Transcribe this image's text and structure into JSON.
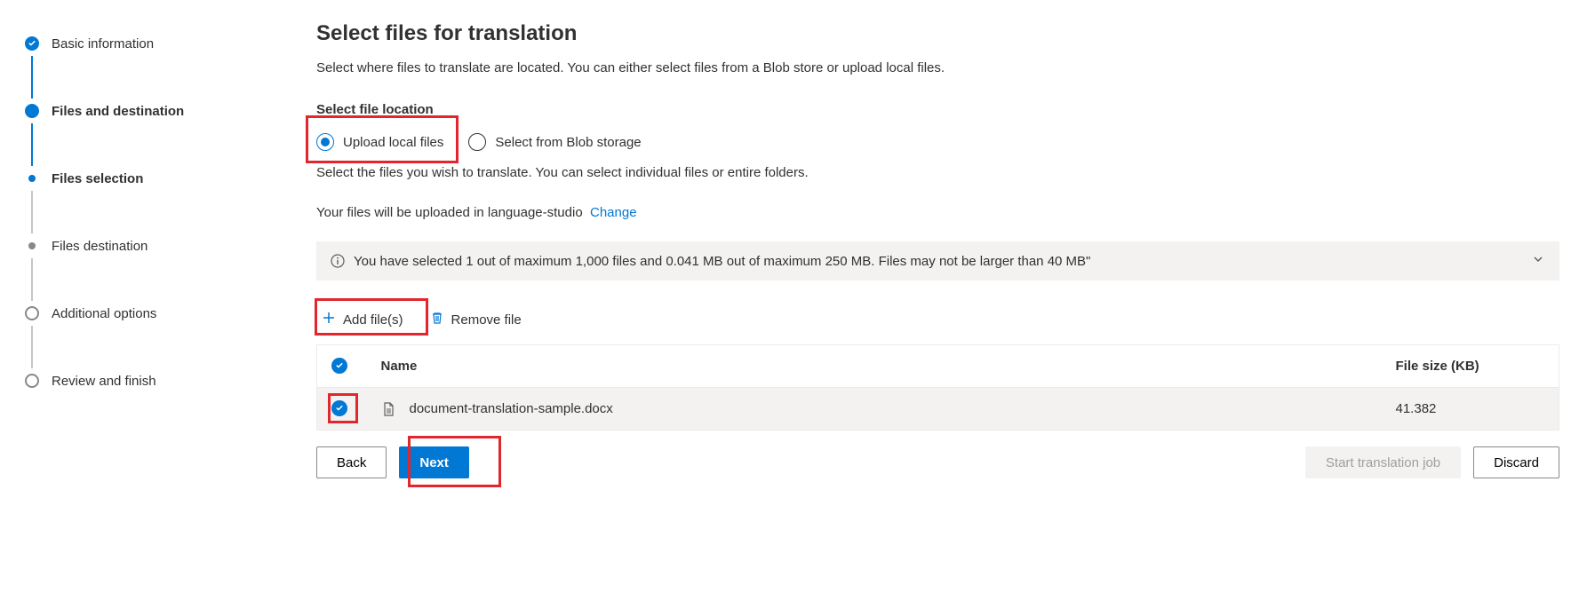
{
  "stepper": {
    "items": [
      {
        "label": "Basic information",
        "state": "done"
      },
      {
        "label": "Files and destination",
        "state": "active",
        "bold": true
      },
      {
        "label": "Files selection",
        "state": "sub-active",
        "bold": true,
        "sub": true
      },
      {
        "label": "Files destination",
        "state": "sub-idle",
        "sub": true
      },
      {
        "label": "Additional options",
        "state": "idle"
      },
      {
        "label": "Review and finish",
        "state": "idle"
      }
    ]
  },
  "main": {
    "title": "Select files for translation",
    "subtitle": "Select where files to translate are located. You can either select files from a Blob store or upload local files.",
    "section_label": "Select file location",
    "radio": {
      "upload_local": "Upload local files",
      "blob": "Select from Blob storage",
      "selected": "upload_local"
    },
    "desc": "Select the files you wish to translate. You can select individual files or entire folders.",
    "upload_prefix": "Your files will be uploaded in language-studio",
    "change_link": "Change",
    "info_bar": "You have selected 1 out of maximum 1,000 files and 0.041 MB out of maximum 250 MB. Files may not be larger than 40 MB\"",
    "toolbar": {
      "add": "Add file(s)",
      "remove": "Remove file"
    },
    "table": {
      "col_name": "Name",
      "col_size": "File size (KB)",
      "rows": [
        {
          "name": "document-translation-sample.docx",
          "size": "41.382",
          "selected": true
        }
      ]
    }
  },
  "footer": {
    "back": "Back",
    "next": "Next",
    "start": "Start translation job",
    "discard": "Discard"
  }
}
